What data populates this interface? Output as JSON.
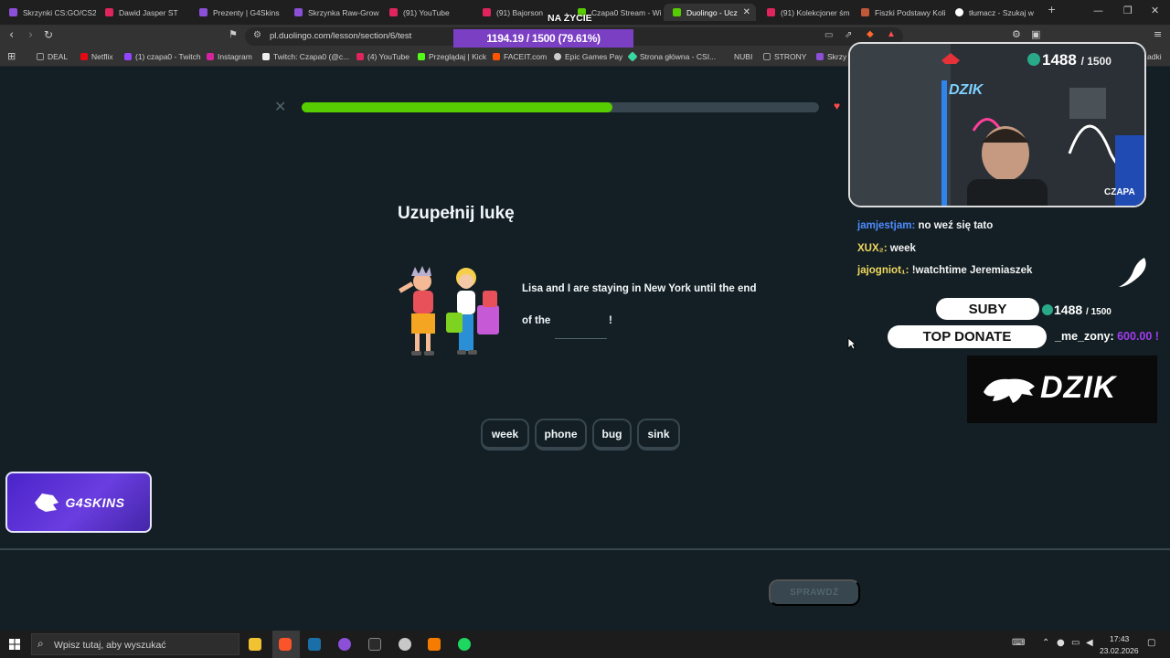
{
  "browser": {
    "tabs": [
      {
        "label": "Skrzynki CS:GO/CS2",
        "color": "#8b4fd8"
      },
      {
        "label": "Dawid Jasper ST",
        "color": "#e0245e"
      },
      {
        "label": "Prezenty | G4Skins",
        "color": "#8b4fd8"
      },
      {
        "label": "Skrzynka Raw-Grow",
        "color": "#8b4fd8"
      },
      {
        "label": "(91) YouTube",
        "color": "#e0245e"
      },
      {
        "label": "(91) Bajorson",
        "color": "#e0245e"
      },
      {
        "label": "Czapa0 Stream - Wi",
        "color": "#58cc02"
      },
      {
        "label": "Duolingo - Ucz",
        "color": "#58cc02"
      },
      {
        "label": "(91) Kolekcjoner śm",
        "color": "#e0245e"
      },
      {
        "label": "Fiszki Podstawy Koli",
        "color": "#c0583a"
      },
      {
        "label": "tłumacz - Szukaj w",
        "color": "#ffffff"
      }
    ],
    "new_tab": "+",
    "url": "pl.duolingo.com/lesson/section/6/test",
    "bookmarks": [
      {
        "label": "DEAL",
        "color": "#9a9a9a"
      },
      {
        "label": "Netflix",
        "color": "#e50914"
      },
      {
        "label": "(1) czapa0 - Twitch",
        "color": "#9146ff"
      },
      {
        "label": "Instagram",
        "color": "#d6249f"
      },
      {
        "label": "Twitch: Czapa0 (@c...",
        "color": "#ffffff"
      },
      {
        "label": "(4) YouTube",
        "color": "#e0245e"
      },
      {
        "label": "Przeglądaj | Kick",
        "color": "#53fc18"
      },
      {
        "label": "FACEIT.com",
        "color": "#ff5500"
      },
      {
        "label": "Epic Games Pay",
        "color": "#cccccc"
      },
      {
        "label": "Strona główna - CSI...",
        "color": "#3ad6a4"
      },
      {
        "label": "NUBI",
        "color": "#555555"
      },
      {
        "label": "STRONY",
        "color": "#9a9a9a"
      },
      {
        "label": "Skrzy",
        "color": "#8b4fd8"
      },
      {
        "label": "adki",
        "color": "#9a9a9a"
      }
    ]
  },
  "overlay_top": {
    "xp_bar": "1194.19 / 1500 (79.61%)",
    "na_zycie": "NA ŻYCIE"
  },
  "lesson": {
    "progress": 0.6,
    "heading": "Uzupełnij lukę",
    "sentence_line1": "Lisa and I are staying in New York until the end",
    "sentence_line2": "of the",
    "sentence_end": "!",
    "word_bank": [
      "week",
      "phone",
      "bug",
      "sink"
    ],
    "check_label": "SPRAWDŹ"
  },
  "stream": {
    "cam_count": "1488",
    "cam_total": "/ 1500",
    "cam_name": "CZAPA",
    "cam_logo": "DZIK",
    "chat": [
      {
        "user": "jamjestjam:",
        "msg": "no weź się tato",
        "color": "#4f8cff"
      },
      {
        "user": "XUX₂:",
        "msg": "week",
        "color": "#f0d860"
      },
      {
        "user": "jajogniot₁:",
        "msg": "!watchtime Jeremiaszek",
        "color": "#f0d860"
      }
    ],
    "suby_label": "SUBY",
    "suby_count": "1488",
    "suby_total": "/ 1500",
    "top_donate_label": "TOP DONATE",
    "top_donor": "_me_zony:",
    "top_donor_amount": "600.00 !",
    "dzik_logo": "DZIK",
    "g4skins": "G4SKINS"
  },
  "taskbar": {
    "search_placeholder": "Wpisz tutaj, aby wyszukać",
    "time": "17:43",
    "date": "23.02.2026"
  }
}
